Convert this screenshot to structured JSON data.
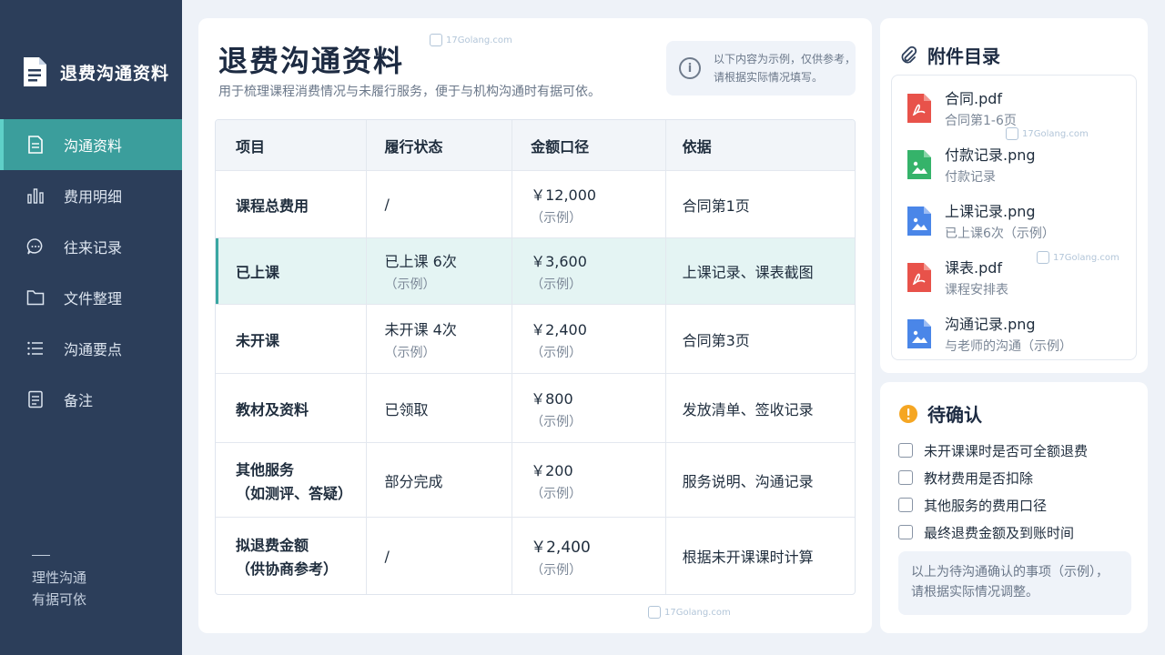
{
  "sidebar": {
    "title": "退费沟通资料",
    "items": [
      {
        "label": "沟通资料",
        "icon": "document-icon"
      },
      {
        "label": "费用明细",
        "icon": "bar-chart-icon"
      },
      {
        "label": "往来记录",
        "icon": "chat-bubble-icon"
      },
      {
        "label": "文件整理",
        "icon": "folder-icon"
      },
      {
        "label": "沟通要点",
        "icon": "list-icon"
      },
      {
        "label": "备注",
        "icon": "note-icon"
      }
    ],
    "footer_line1": "理性沟通",
    "footer_line2": "有据可依"
  },
  "main": {
    "title": "退费沟通资料",
    "subtitle": "用于梳理课程消费情况与未履行服务，便于与机构沟通时有据可依。",
    "note_line1": "以下内容为示例，仅供参考，",
    "note_line2": "请根据实际情况填写。"
  },
  "table": {
    "headers": [
      "项目",
      "履行状态",
      "金额口径",
      "依据"
    ],
    "rows": [
      {
        "item": "课程总费用",
        "item_sub": "",
        "status": "/",
        "status_sub": "",
        "amount": "￥12,000",
        "amount_sub": "（示例）",
        "basis": "合同第1页"
      },
      {
        "item": "已上课",
        "item_sub": "",
        "status": "已上课 6次",
        "status_sub": "（示例）",
        "amount": "￥3,600",
        "amount_sub": "（示例）",
        "basis": "上课记录、课表截图"
      },
      {
        "item": "未开课",
        "item_sub": "",
        "status": "未开课 4次",
        "status_sub": "（示例）",
        "amount": "￥2,400",
        "amount_sub": "（示例）",
        "basis": "合同第3页"
      },
      {
        "item": "教材及资料",
        "item_sub": "",
        "status": "已领取",
        "status_sub": "",
        "amount": "￥800",
        "amount_sub": "（示例）",
        "basis": "发放清单、签收记录"
      },
      {
        "item": "其他服务",
        "item_sub": "（如测评、答疑）",
        "status": "部分完成",
        "status_sub": "",
        "amount": "￥200",
        "amount_sub": "（示例）",
        "basis": "服务说明、沟通记录"
      },
      {
        "item": "拟退费金额",
        "item_sub": "（供协商参考）",
        "status": "/",
        "status_sub": "",
        "amount": "￥2,400",
        "amount_sub": "（示例）",
        "basis": "根据未开课课时计算"
      }
    ]
  },
  "attachments": {
    "title": "附件目录",
    "files": [
      {
        "name": "合同.pdf",
        "desc": "合同第1-6页",
        "type": "pdf",
        "color": "#e8524a"
      },
      {
        "name": "付款记录.png",
        "desc": "付款记录",
        "type": "image",
        "color": "#35b36a"
      },
      {
        "name": "上课记录.png",
        "desc": "已上课6次（示例）",
        "type": "image",
        "color": "#4a86e8"
      },
      {
        "name": "课表.pdf",
        "desc": "课程安排表",
        "type": "pdf",
        "color": "#e8524a"
      },
      {
        "name": "沟通记录.png",
        "desc": "与老师的沟通（示例）",
        "type": "image",
        "color": "#4a86e8"
      }
    ]
  },
  "pending": {
    "title": "待确认",
    "items": [
      "未开课课时是否可全额退费",
      "教材费用是否扣除",
      "其他服务的费用口径",
      "最终退费金额及到账时间"
    ],
    "note_line1": "以上为待沟通确认的事项（示例），",
    "note_line2": "请根据实际情况调整。"
  },
  "watermark": "17Golang.com",
  "colors": {
    "sidebar_bg": "#2c3e5a",
    "accent_teal": "#3b9e9c",
    "highlight_row": "#e4f4f3",
    "warning": "#f5a623"
  }
}
